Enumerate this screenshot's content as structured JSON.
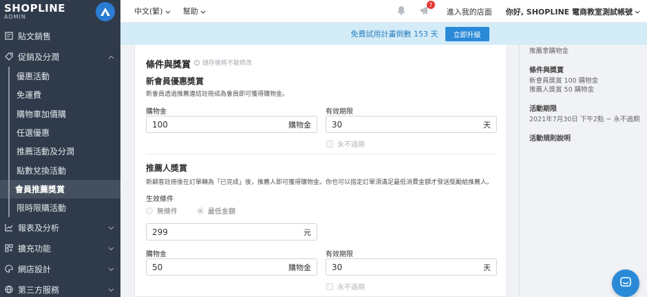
{
  "brand": {
    "logo_main": "SHOPLINE",
    "logo_sub": "ADMIN"
  },
  "sidebar": {
    "items": [
      {
        "label": "貼文銷售"
      },
      {
        "label": "促銷及分潤"
      },
      {
        "label": "報表及分析"
      },
      {
        "label": "擴充功能"
      },
      {
        "label": "網店設計"
      },
      {
        "label": "第三方服務"
      }
    ],
    "sub_items": [
      {
        "label": "優惠活動"
      },
      {
        "label": "免運費"
      },
      {
        "label": "購物車加價購"
      },
      {
        "label": "任選優惠"
      },
      {
        "label": "推薦活動及分潤"
      },
      {
        "label": "點數兌換活動"
      },
      {
        "label": "會員推薦獎賞"
      },
      {
        "label": "限時限購活動"
      }
    ]
  },
  "topbar": {
    "language": "中文(繁)",
    "help": "幫助",
    "notification_count": "7",
    "store_link": "進入我的店面",
    "user_greeting": "你好, SHOPLINE 電商教室測試帳號"
  },
  "banner": {
    "text": "免費試用計畫倒數 153 天",
    "button": "立即升級"
  },
  "form": {
    "title": "條件與獎賞",
    "note": "儲存後將不能修改",
    "new_member": {
      "heading": "新會員優惠獎賞",
      "desc": "新會員透過推薦連結註冊成為會員即可獲得購物金。",
      "credit_label": "購物金",
      "credit_value": "100",
      "credit_unit": "購物金",
      "validity_label": "有效期限",
      "validity_value": "30",
      "validity_unit": "天",
      "never_expire": "永不過期"
    },
    "referrer": {
      "heading": "推薦人獎賞",
      "desc": "新顧客註冊後在訂單轉為「已完成」後，推薦人即可獲得購物金。你也可以指定訂單須滿足最低消費金額才發送獎勵給推薦人。",
      "condition_label": "生效條件",
      "option_none": "無條件",
      "option_min": "最低金額",
      "min_value": "299",
      "min_unit": "元",
      "credit_label": "購物金",
      "credit_value": "50",
      "credit_unit": "購物金",
      "validity_label": "有效期限",
      "validity_value": "30",
      "validity_unit": "天",
      "never_expire": "永不過期"
    }
  },
  "summary": {
    "top_text": "推薦拿購物金",
    "cond_heading": "條件與獎賞",
    "cond_line1": "新會員獎賞 100 購物金",
    "cond_line2": "推薦人獎賞 50 購物金",
    "period_heading": "活動期限",
    "period_text": "2021年7月30日 下午2點 ~ 永不過期",
    "rules_heading": "活動規則說明"
  },
  "colors": {
    "sidebar_bg": "#2f3a4a",
    "accent": "#2b8ad8",
    "banner_bg": "#d4ecf8"
  }
}
